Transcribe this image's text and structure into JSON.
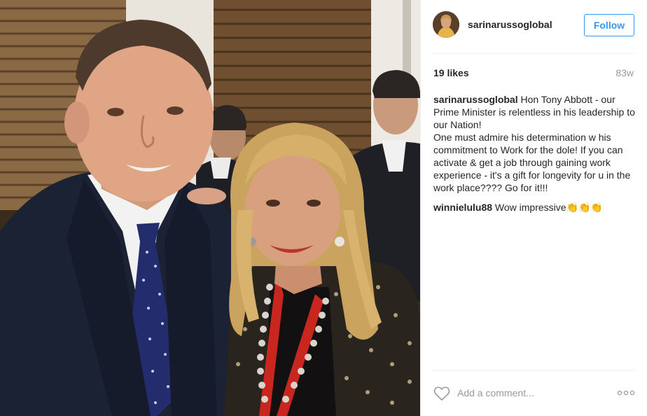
{
  "post": {
    "username": "sarinarussoglobal",
    "follow_label": "Follow",
    "likes": "19 likes",
    "age": "83w",
    "caption": {
      "user": "sarinarussoglobal",
      "text": "Hon Tony Abbott - our Prime Minister is relentless in his leadership to our Nation!\nOne must admire his determination w his commitment to Work for the dole! If you can activate & get a job through gaining work experience - it's a gift for longevity for u in the work place???? Go for it!!!"
    },
    "comments": [
      {
        "user": "winnielulu88",
        "text": "Wow impressive",
        "emoji": "👏👏👏"
      }
    ],
    "add_comment_placeholder": "Add a comment...",
    "icons": {
      "like": "heart-outline-icon",
      "more": "more-options-icon"
    },
    "colors": {
      "accent": "#3897f0",
      "muted": "#999999",
      "text": "#262626"
    }
  }
}
